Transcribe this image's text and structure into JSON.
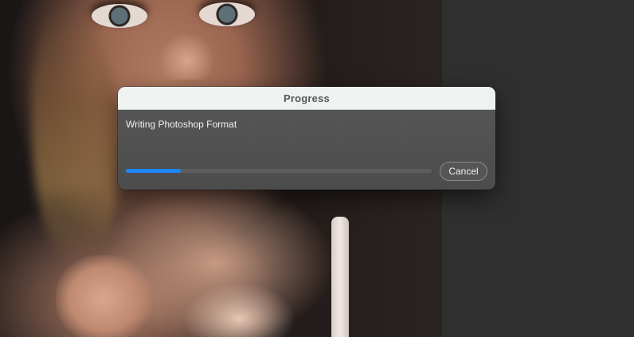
{
  "dialog": {
    "title": "Progress",
    "message": "Writing Photoshop Format",
    "progress": 0.18,
    "cancel_label": "Cancel"
  },
  "colors": {
    "accent": "#1e86f7",
    "titlebar_bg": "#eef2f1",
    "dialog_bg": "#525252",
    "panel_bg": "#2f2f2f"
  }
}
